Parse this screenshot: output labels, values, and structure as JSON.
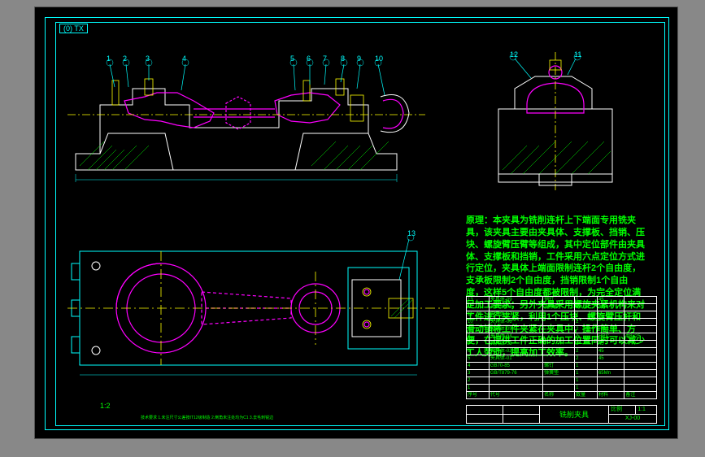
{
  "top_tag": "(0) TX",
  "balloons": {
    "b1": "1",
    "b2": "2",
    "b3": "3",
    "b4": "4",
    "b5": "5",
    "b6": "6",
    "b7": "7",
    "b8": "8",
    "b9": "9",
    "b10": "10",
    "b11": "11",
    "b12": "12",
    "b13": "13"
  },
  "description": "原理：本夹具为铣削连杆上下端面专用铣夹具，该夹具主要由夹具体、支撑板、挡销、压块、螺旋臂压臂等组成，其中定位部件由夹具体、支撑板和挡销，工件采用六点定位方式进行定位，夹具体上端面限制连杆2个自由度，支承板限制2个自由度，挡销限制1个自由度，这样5个自由度都被限制，为完全定位满足加工要求；另外夹具采用螺旋夹紧机构来对工件进行夹紧，利用1个压块、螺旋臂压杆和滑动销将工件夹紧在夹具中，操作简单、方便，在提供工件正确的加工位置同时可以减少工人劳动，提高加工效率。",
  "bom_header": {
    "c1": "序号",
    "c2": "代号",
    "c3": "名称",
    "c4": "数量",
    "c5": "材料",
    "c6": "备注"
  },
  "bom_rows": [
    {
      "n": "13",
      "code": "夹具体-09",
      "name": "销钉",
      "qty": "1",
      "mat": "45",
      "": ""
    },
    {
      "n": "12",
      "code": "夹具体-08",
      "name": "支撑板",
      "qty": "1",
      "mat": "45",
      "note": ""
    },
    {
      "n": "11",
      "code": "夹具体-07",
      "name": "",
      "qty": "2",
      "mat": "",
      "note": ""
    },
    {
      "n": "10",
      "code": "夹具体-06",
      "name": "",
      "qty": "2",
      "mat": "",
      "note": ""
    },
    {
      "n": "9",
      "code": "夹具体-05",
      "name": "",
      "qty": "2",
      "mat": "HRC",
      "note": ""
    },
    {
      "n": "8",
      "code": "夹具体-04",
      "name": "",
      "qty": "2",
      "mat": "HRC",
      "note": "Φ8×25"
    },
    {
      "n": "7",
      "code": "夹具体-03",
      "name": "",
      "qty": "1",
      "mat": "45",
      "note": ""
    },
    {
      "n": "6",
      "code": "夹具体-02",
      "name": "",
      "qty": "2",
      "mat": "45",
      "note": ""
    },
    {
      "n": "5",
      "code": "夹具体-01",
      "name": "",
      "qty": "2",
      "mat": "45",
      "note": ""
    },
    {
      "n": "4",
      "code": "GB70-85",
      "name": "螺钉",
      "qty": "1",
      "mat": "",
      "note": ""
    },
    {
      "n": "3",
      "code": "GB/T879-76",
      "name": "弹簧垫",
      "qty": "1",
      "mat": "65Mn",
      "note": ""
    },
    {
      "n": "2",
      "code": "",
      "name": "",
      "qty": "1",
      "mat": "",
      "note": ""
    },
    {
      "n": "1",
      "code": "",
      "name": "",
      "qty": "1",
      "mat": "",
      "note": ""
    }
  ],
  "title_block": {
    "dwg_name": "铣削夹具",
    "dwg_no": "XJ-00",
    "scale_label": "比例",
    "scale_val": "1:1"
  },
  "scale_text": "1:2",
  "tech_reqs": "技术要求\n1.未注尺寸公差按IT12级制造\n2.倒角未注处均为C1\n3.去毛刺锐边"
}
